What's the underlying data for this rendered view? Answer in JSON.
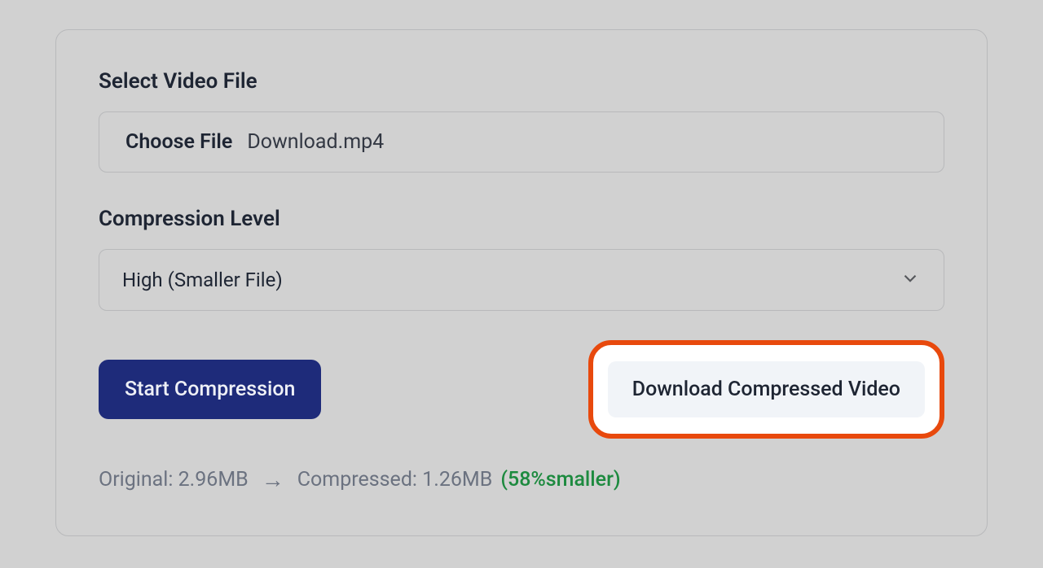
{
  "file": {
    "label": "Select Video File",
    "choose_label": "Choose File",
    "name": "Download.mp4"
  },
  "compression": {
    "label": "Compression Level",
    "selected": "High (Smaller File)"
  },
  "actions": {
    "start_label": "Start Compression",
    "download_label": "Download Compressed Video"
  },
  "stats": {
    "original": "Original: 2.96MB",
    "arrow": "→",
    "compressed": "Compressed: 1.26MB",
    "reduction": "(58%smaller)"
  }
}
